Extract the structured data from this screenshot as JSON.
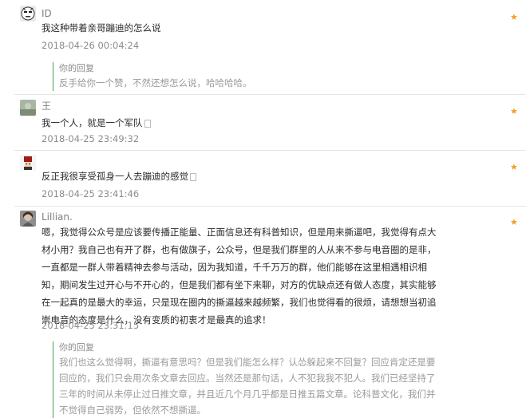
{
  "comments": [
    {
      "username": "ID",
      "content": "我这种带着亲哥蹦迪的怎么说",
      "time": "2018-04-26 00:04:24",
      "reply": {
        "label": "你的回复",
        "text": "反手给你一个赞，不然还想怎么说，哈哈哈哈。"
      }
    },
    {
      "username": "王",
      "content": "我一个人，就是一个军队",
      "time": "2018-04-25 23:49:32"
    },
    {
      "username": "",
      "content": "反正我很享受孤身一人去蹦迪的感觉",
      "time": "2018-04-25 23:41:46"
    },
    {
      "username": "Lillian.",
      "content_lines": [
        "嗯，我觉得公众号是应该要传播正能量、正面信息还有科普知识，但是用来撕逼吧，我觉得有点大",
        "材小用？我自己也有开了群，也有做旗子，公众号，但是我们群里的人从来不参与电音圈的是非，",
        "一直都是一群人带着精神去参与活动，因为我知道，千千万万的群，他们能够在这里相遇相识相",
        "知，期间发生过开心与不开心的，但是我们都有坐下来聊，对方的优缺点还有做人态度，其实能够",
        "在一起真的是最大的幸运，只是现在圈内的撕逼越来越频繁，我们也觉得看的很烦，请想想当初追",
        "崇电音的态度是什么，没有变质的初衷才是最真的追求！"
      ],
      "time": "2018-04-25 23:31:15",
      "reply": {
        "label": "你的回复",
        "lines": [
          "我们也这么觉得啊，撕逼有意思吗？但是我们能怎么样？认怂躲起来不回复？回应肯定还是要",
          "回应的，我们只会用次条文章去回应。当然还是那句话，人不犯我我不犯人。我们已经坚持了",
          "三年的时间从未停止过日推文章，并且近几个月几乎都是日推五篇文章。论科普文化，我们并",
          "不觉得自己弱势，但依然不想撕逼。"
        ]
      }
    }
  ],
  "icons": {
    "star": "star-icon"
  },
  "colors": {
    "star": "#f0a020",
    "reply_border": "#3da34d"
  }
}
